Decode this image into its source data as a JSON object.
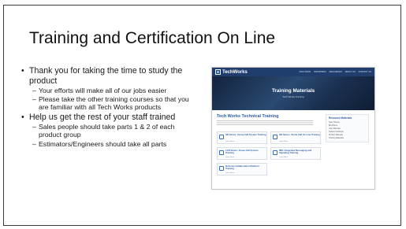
{
  "title": "Training and Certification On Line",
  "bullets": [
    {
      "text": "Thank you for taking the time to study the product",
      "sub": [
        "Your efforts will make all of our jobs easier",
        "Please take the other training courses so that you are familiar with all Tech Works products"
      ]
    },
    {
      "text": "Help us get the rest of your staff trained",
      "sub": [
        "Sales people should take parts 1 & 2 of each product group",
        "Estimators/Engineers should take all parts"
      ]
    }
  ],
  "screenshot": {
    "brand": "TechWorks",
    "nav": [
      "SOLUTIONS",
      "INDUSTRIES",
      "RESOURCES",
      "ABOUT US",
      "CONTACT US"
    ],
    "hero_title": "Training Materials",
    "hero_sub": "Tech Works Training",
    "section_title": "Tech Works Technical Training",
    "cards": [
      {
        "label": "HD Series: Venue Call System Training",
        "link": "Learn More"
      },
      {
        "label": "HD Series: Venue Call for Line Training",
        "link": "Learn More"
      },
      {
        "label": "LCD Series: Venue Call System Training",
        "link": "Learn More"
      },
      {
        "label": "IMS: Integrated Messaging and Signaling Training",
        "link": "Learn More"
      },
      {
        "label": "IS Series Collaboration Platform Training",
        "link": "Learn More"
      }
    ],
    "sidebar": {
      "heading": "Resource Materials",
      "items": [
        "Spec Sheets",
        "Brochures",
        "User Manuals",
        "System Drawings",
        "Product Manuals",
        "Training Materials"
      ]
    }
  },
  "colors": {
    "nav": "#1f3e6e",
    "accent": "#2c5da0"
  }
}
